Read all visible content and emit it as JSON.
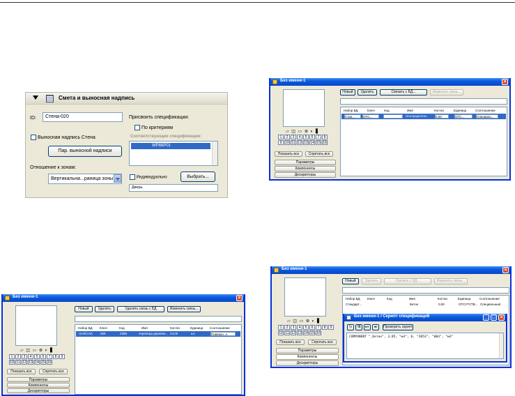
{
  "smeta": {
    "header": "Смета и выносная надпись",
    "id_label": "ID:",
    "id_value": "Стена-020",
    "assign_label": "Присвоить спецификации:",
    "by_criteria": "По критериям",
    "matching_label": "Соответствующие  спецификации:",
    "list_item": "WP88P01",
    "callout_label": "Выносная надпись Стена",
    "callout_params_button": "Пар. выносной надписи",
    "zones_label": "Отношение к зонам:",
    "zones_value": "Вертикальна...раница зоны",
    "individual_label": "Индивидуально",
    "select_button": "Выбрать...",
    "door_label": "Дверь"
  },
  "common": {
    "window_title": "Без имени-1",
    "btn_new": "Новый",
    "btn_delete": "Удалить",
    "btn_link_db": "Связать с БД...",
    "btn_unlink_db": "Удалить связь с БД",
    "btn_change_link": "Изменить связь...",
    "col_db_set": "Набор БД",
    "col_key": "Ключ",
    "col_code": "Код",
    "col_name": "Имя",
    "col_qty": "Кол-во",
    "col_unit": "Единица",
    "col_relation": "Соотношение",
    "show_all": "Показать все",
    "hide_all": "Спрятать все",
    "tab_params": "Параметры",
    "tab_components": "Компоненты",
    "tab_descriptors": "Дескрипторы",
    "view_icons": "▱ ◫ ▭ ⊛ ◐ ▋",
    "numbers": [
      "1",
      "2",
      "3",
      "4",
      "5",
      "6",
      "7",
      "8",
      "9",
      "10",
      "11",
      "12",
      "13",
      "14",
      "15",
      "16"
    ]
  },
  "win_top_right": {
    "row": {
      "db": "Стан...",
      "key": "ОТС...",
      "code": "",
      "name": "Неопределено",
      "qty": "0,00",
      "unit": "ОТС...",
      "relation": "Специаль..."
    }
  },
  "win_bottom_left": {
    "row": {
      "db": "ArchiCAD",
      "key": "009",
      "code": "2355",
      "name": "черепица деревян...",
      "qty": "24,00",
      "unit": "шт.",
      "relation": "Поверхн. А"
    }
  },
  "win_bottom_right": {
    "row": {
      "db": "Стандарт...",
      "key": "",
      "code": "",
      "name": "Бетон",
      "qty": "0,00",
      "unit": "ОТСУТСТВ...",
      "relation": "Специальный"
    },
    "script_title": "Без имени-1 / Скрипт спецификаций",
    "check_script": "Проверить скрипт",
    "script_text": "COMPONENT \"_бетон\", 3.85, \"м3\", 6, \"2053\", \"003\", \"м3\""
  }
}
